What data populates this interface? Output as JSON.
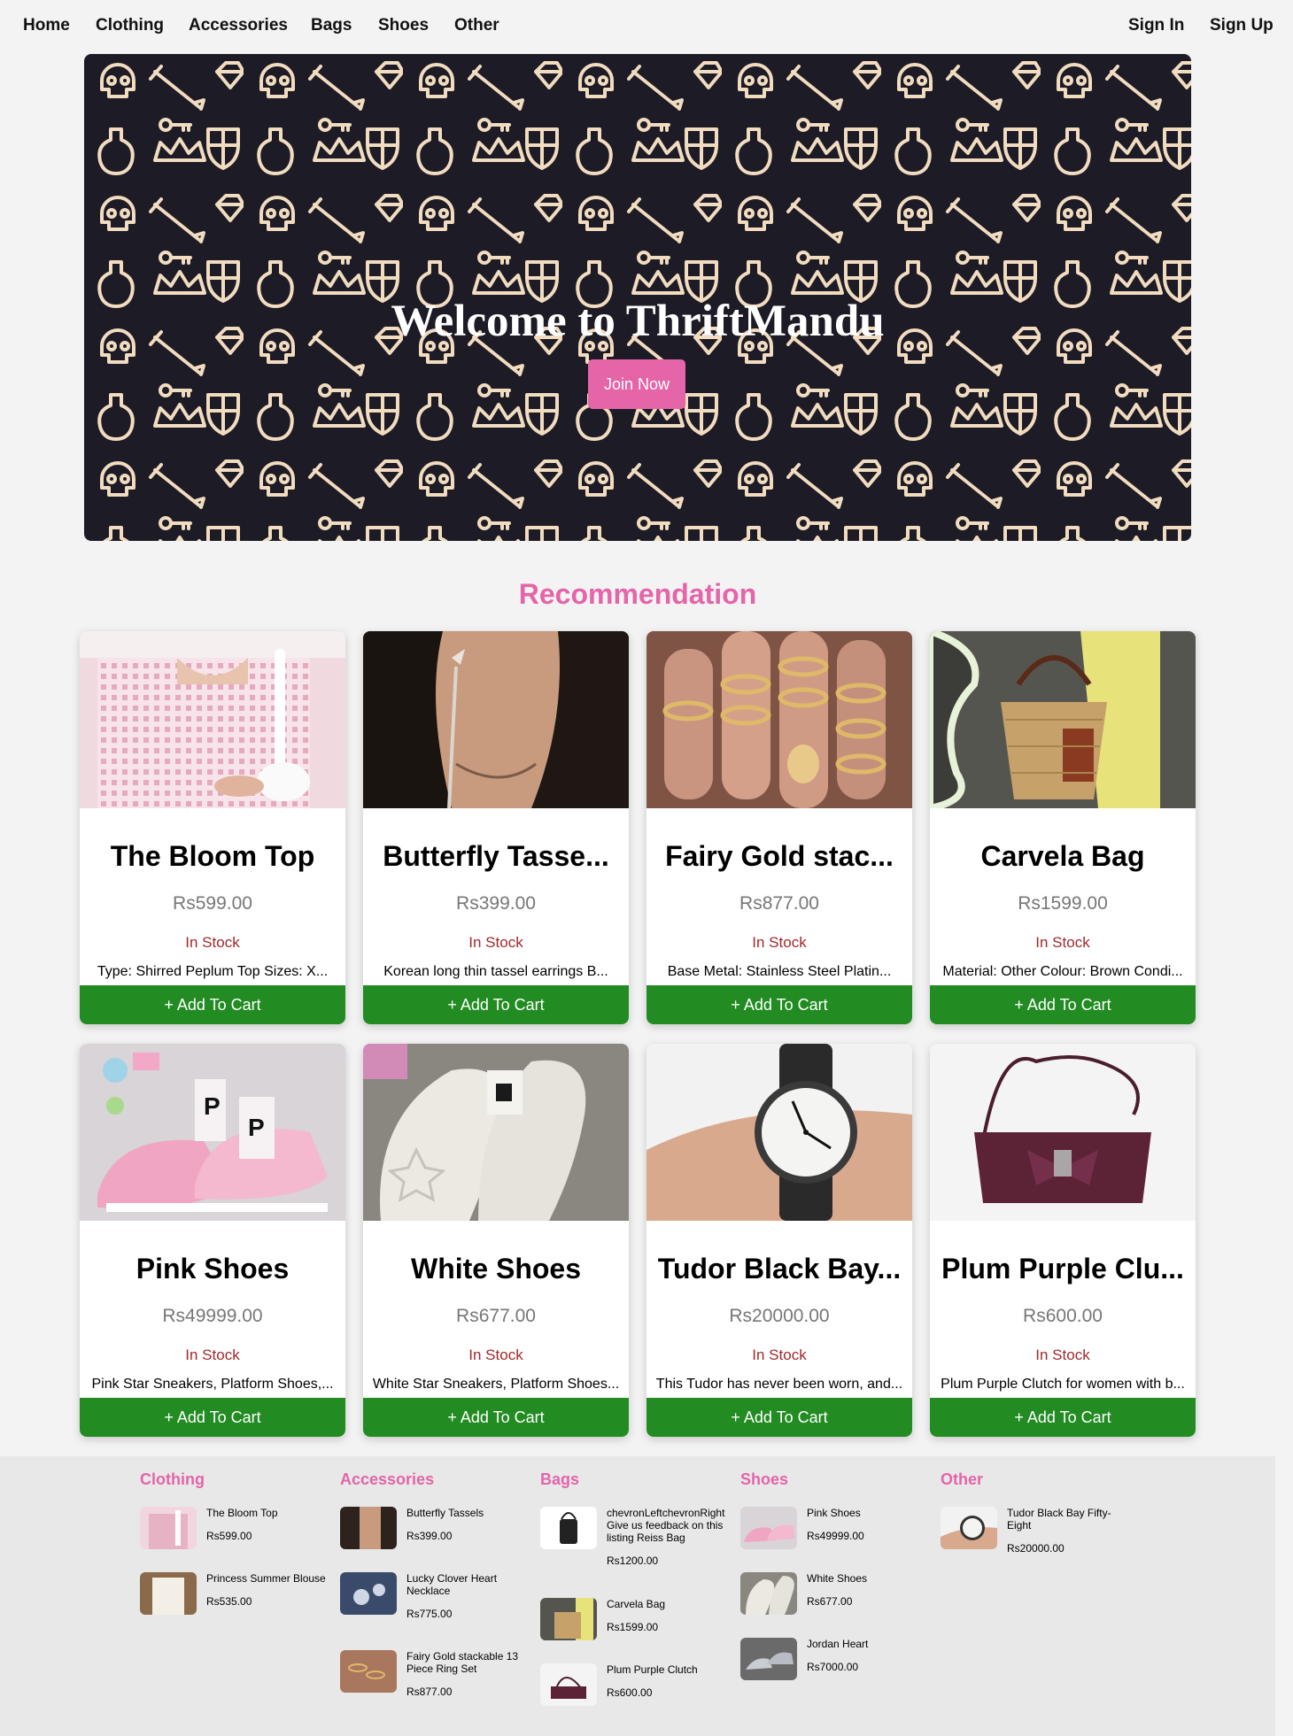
{
  "nav": {
    "home": "Home",
    "clothing": "Clothing",
    "accessories": "Accessories",
    "bags": "Bags",
    "shoes": "Shoes",
    "other": "Other",
    "sign_in": "Sign In",
    "sign_up": "Sign Up"
  },
  "hero": {
    "title": "Welcome to ThriftMandu",
    "button": "Join Now"
  },
  "recommendation": {
    "title": "Recommendation",
    "cart_label": "+ Add To Cart",
    "products": [
      {
        "name": "The Bloom Top",
        "price": "Rs599.00",
        "stock": "In Stock",
        "desc": "Type: Shirred Peplum Top Sizes: X..."
      },
      {
        "name": "Butterfly Tasse...",
        "price": "Rs399.00",
        "stock": "In Stock",
        "desc": "Korean long thin tassel earrings B..."
      },
      {
        "name": "Fairy Gold stac...",
        "price": "Rs877.00",
        "stock": "In Stock",
        "desc": "Base Metal: Stainless Steel Platin..."
      },
      {
        "name": "Carvela Bag",
        "price": "Rs1599.00",
        "stock": "In Stock",
        "desc": "Material: Other Colour: Brown Condi..."
      },
      {
        "name": "Pink Shoes",
        "price": "Rs49999.00",
        "stock": "In Stock",
        "desc": "Pink Star Sneakers, Platform Shoes,..."
      },
      {
        "name": "White Shoes",
        "price": "Rs677.00",
        "stock": "In Stock",
        "desc": "White Star Sneakers, Platform Shoes..."
      },
      {
        "name": "Tudor Black Bay...",
        "price": "Rs20000.00",
        "stock": "In Stock",
        "desc": "This Tudor has never been worn, and..."
      },
      {
        "name": "Plum Purple Clu...",
        "price": "Rs600.00",
        "stock": "In Stock",
        "desc": "Plum Purple Clutch for women with b..."
      }
    ]
  },
  "footer": {
    "clothing": {
      "title": "Clothing",
      "items": [
        {
          "name": "The Bloom Top",
          "price": "Rs599.00"
        },
        {
          "name": "Princess Summer Blouse",
          "price": "Rs535.00"
        }
      ]
    },
    "accessories": {
      "title": "Accessories",
      "items": [
        {
          "name": "Butterfly Tassels",
          "price": "Rs399.00"
        },
        {
          "name": "Lucky Clover Heart Necklace",
          "price": "Rs775.00"
        },
        {
          "name": "Fairy Gold stackable 13 Piece Ring Set",
          "price": "Rs877.00"
        }
      ]
    },
    "bags": {
      "title": "Bags",
      "items": [
        {
          "name": "chevronLeftchevronRight Give us feedback on this listing Reiss Bag",
          "price": "Rs1200.00"
        },
        {
          "name": "Carvela Bag",
          "price": "Rs1599.00"
        },
        {
          "name": "Plum Purple Clutch",
          "price": "Rs600.00"
        }
      ]
    },
    "shoes": {
      "title": "Shoes",
      "items": [
        {
          "name": "Pink Shoes",
          "price": "Rs49999.00"
        },
        {
          "name": "White Shoes",
          "price": "Rs677.00"
        },
        {
          "name": "Jordan Heart",
          "price": "Rs7000.00"
        }
      ]
    },
    "other": {
      "title": "Other",
      "items": [
        {
          "name": "Tudor Black Bay Fifty-Eight",
          "price": "Rs20000.00"
        }
      ]
    }
  },
  "colors": {
    "accent_pink": "#e465a8",
    "cart_green": "#228b22",
    "stock_red": "#a3282a",
    "hero_bg": "#1d1b26"
  }
}
